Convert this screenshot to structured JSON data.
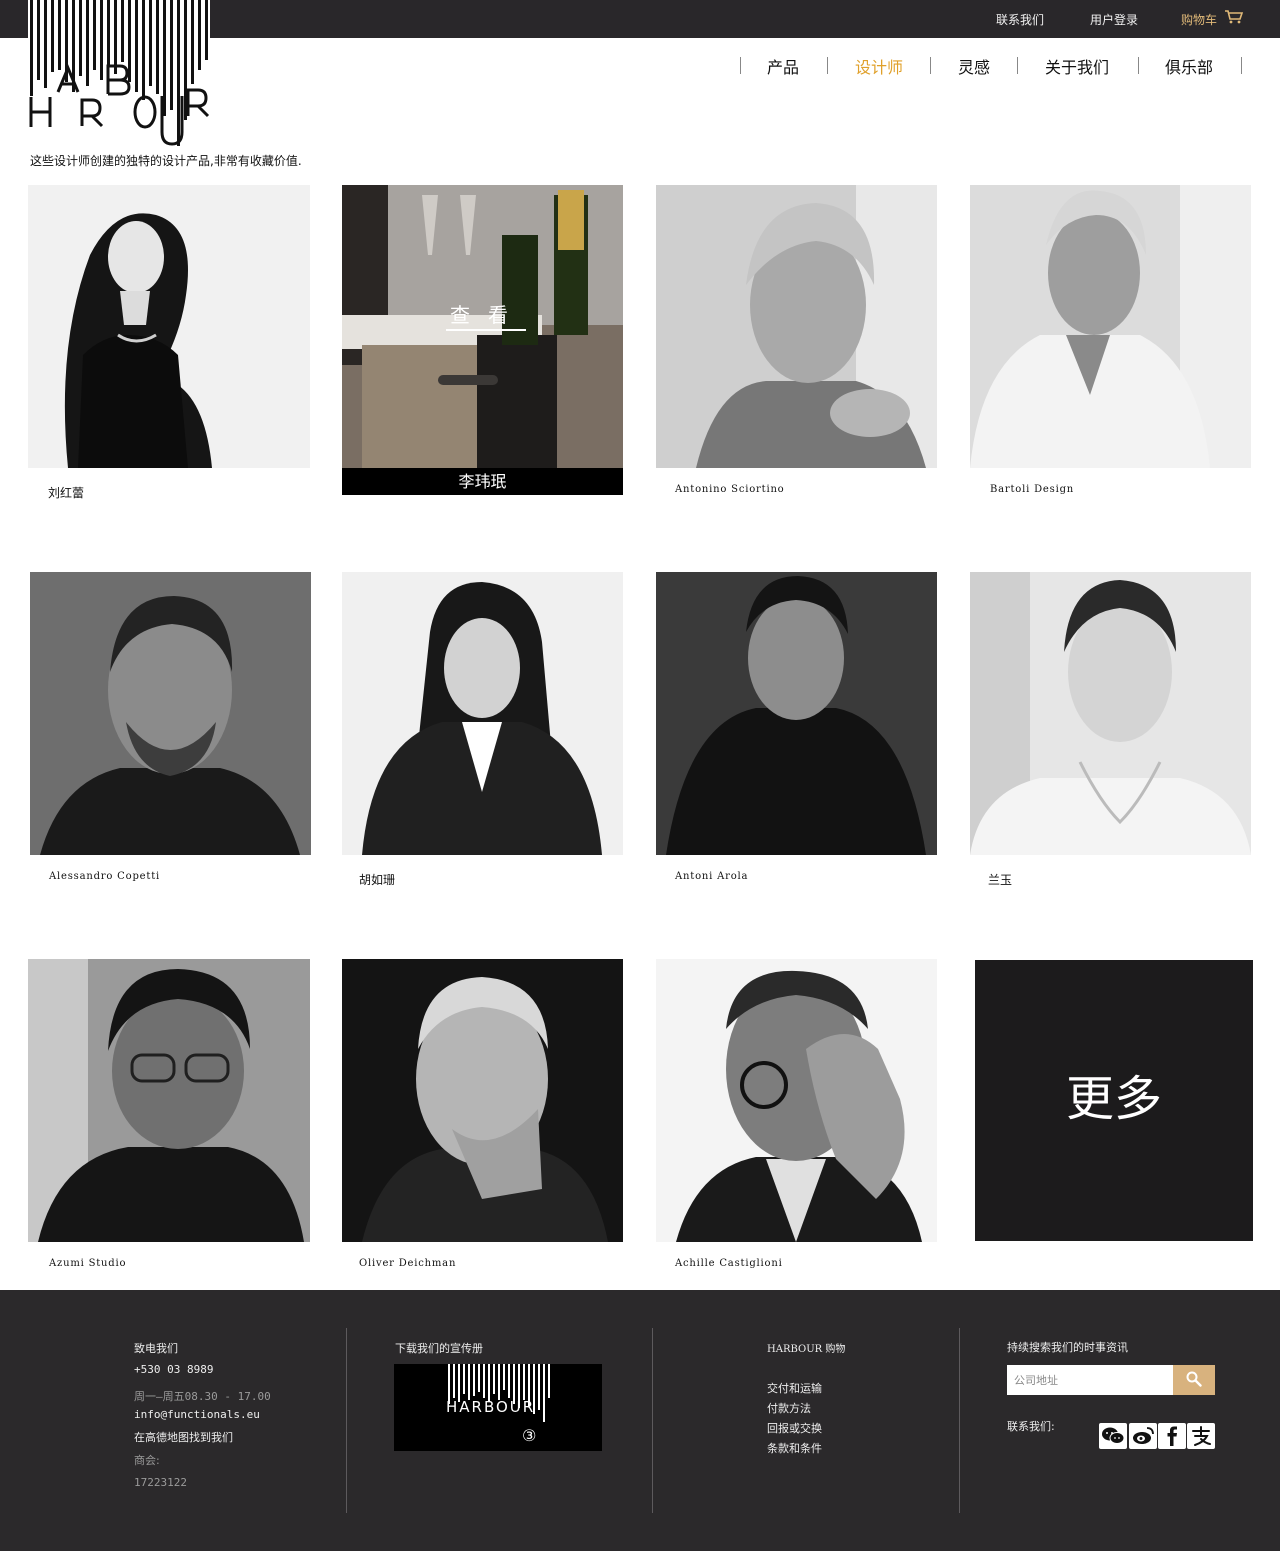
{
  "topbar": {
    "contact": "联系我们",
    "login": "用户登录",
    "cart": "购物车",
    "cart_icon": "shopping-cart-icon",
    "accent_color": "#e0b978"
  },
  "logo": {
    "text": "HARBOUR"
  },
  "nav": {
    "items": [
      {
        "label": "产品"
      },
      {
        "label": "设计师",
        "active": true
      },
      {
        "label": "灵感"
      },
      {
        "label": "关于我们"
      },
      {
        "label": "俱乐部"
      }
    ],
    "active_color": "#e0a02a"
  },
  "intro": "这些设计师创建的独特的设计产品,非常有收藏价值.",
  "designers": [
    {
      "name": "刘红蕾"
    },
    {
      "name": "李玮珉",
      "hover_label": "查看"
    },
    {
      "name": "Antonino Sciortino"
    },
    {
      "name": "Bartoli Design"
    },
    {
      "name": "Alessandro Copetti"
    },
    {
      "name": "胡如珊"
    },
    {
      "name": "Antoni Arola"
    },
    {
      "name": "兰玉"
    },
    {
      "name": "Azumi Studio"
    },
    {
      "name": "Oliver Deichman"
    },
    {
      "name": "Achille Castiglioni"
    }
  ],
  "more_label": "更多",
  "footer": {
    "phone": {
      "title": "致电我们",
      "number": "+530 03 8989",
      "hours": "周一—周五08.30 - 17.00",
      "email": "info@functionals.eu",
      "map": "在高德地图找到我们",
      "chamber_label": "商会:",
      "chamber_number": "17223122"
    },
    "brochure": {
      "title": "下载我们的宣传册",
      "logo_text": "HARBOUR",
      "issue": "③"
    },
    "shop": {
      "title": "HARBOUR 购物",
      "links": [
        "交付和运输",
        "付款方法",
        "回报或交换",
        "条款和条件"
      ]
    },
    "news": {
      "title": "持续搜索我们的时事资讯",
      "search_placeholder": "公司地址",
      "search_icon": "search-icon",
      "follow_label": "联系我们:",
      "social_icons": [
        "wechat-icon",
        "weibo-icon",
        "facebook-icon",
        "alipay-icon"
      ]
    }
  }
}
